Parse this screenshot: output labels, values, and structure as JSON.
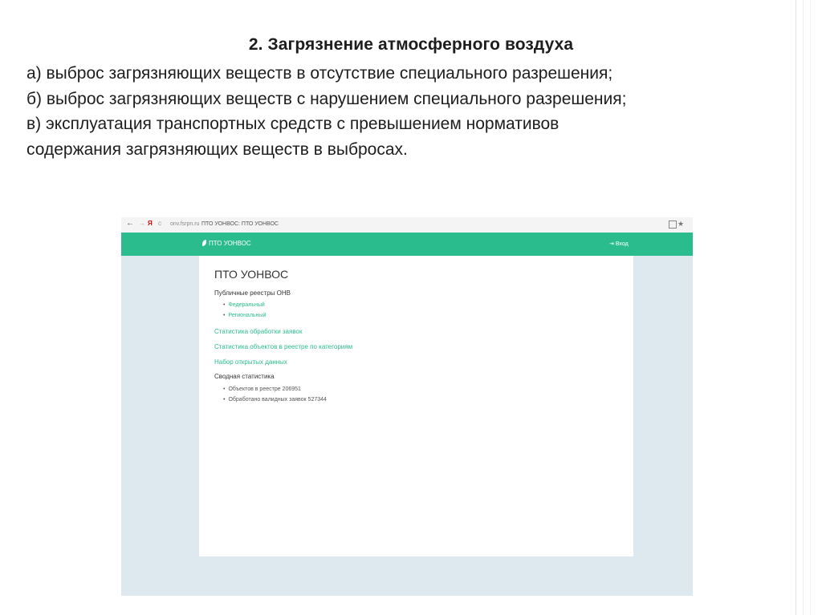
{
  "slide": {
    "title": "2. Загрязнение атмосферного воздуха",
    "lines": [
      "а) выброс загрязняющих веществ в отсутствие специального разрешения;",
      "б) выброс загрязняющих веществ с нарушением специального разрешения;",
      "в) эксплуатация транспортных средств с превышением нормативов",
      "содержания загрязняющих веществ в выбросах."
    ]
  },
  "browser": {
    "back_icon": "←",
    "forward_icon": "→",
    "yandex_icon": "Я",
    "lock_icon": "c",
    "url": "onv.fsrpn.ru",
    "tab_title": "ПТО УОНВОС: ПТО УОНВОС",
    "star_icon": "★"
  },
  "site": {
    "logo_text": "ПТО УОНВОС",
    "login_label": "Вход",
    "login_icon": "⇥",
    "accent_color": "#2bbc8e",
    "page_title": "ПТО УОНВОС",
    "registries_heading": "Публичные реестры ОНВ",
    "registries": [
      "Федеральный",
      "Региональный"
    ],
    "links": [
      "Статистика обработки заявок",
      "Статистика объектов в реестре по категориям",
      "Набор открытых данных"
    ],
    "summary_heading": "Сводная статистика",
    "summary_items": [
      "Объектов в реестре 206951",
      "Обработано валидных заявок 527344"
    ]
  }
}
